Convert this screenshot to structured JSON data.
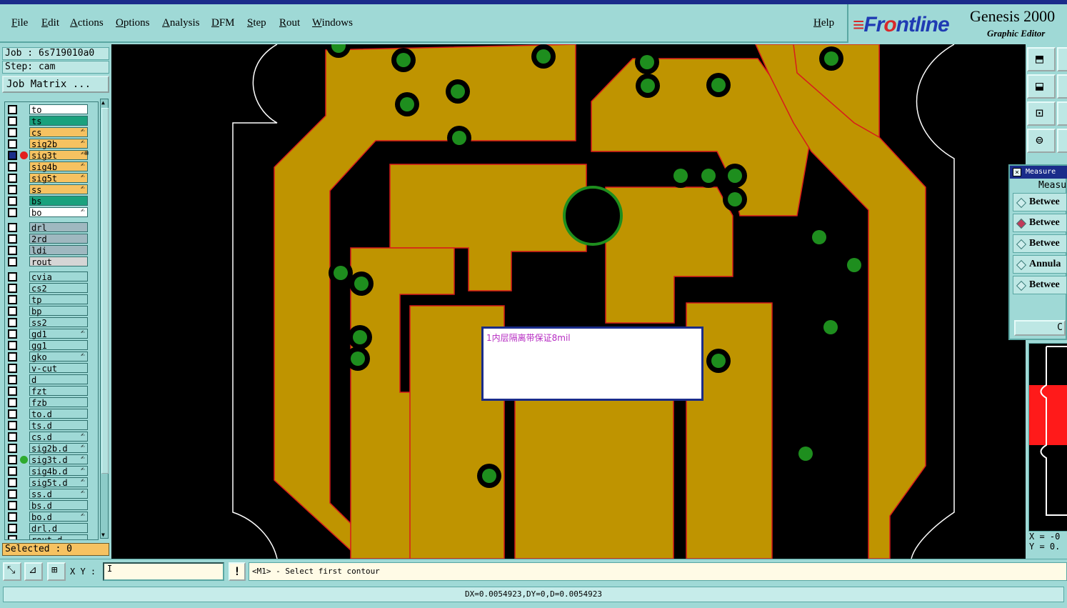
{
  "menu": {
    "items": [
      "File",
      "Edit",
      "Actions",
      "Options",
      "Analysis",
      "DFM",
      "Step",
      "Rout",
      "Windows"
    ],
    "help": "Help"
  },
  "logo": {
    "brand_left": "Fr",
    "brand_mid": "o",
    "brand_right": "ntline",
    "product": "Genesis 2000",
    "subtitle": "Graphic Editor"
  },
  "job": {
    "job_line": "Job : 6s719010a0",
    "step_line": "Step: cam",
    "matrix_button": "Job Matrix ..."
  },
  "layers": [
    {
      "name": "to",
      "bg": "#ffffff",
      "flag": "",
      "dot": ""
    },
    {
      "name": "ts",
      "bg": "#1aa17d",
      "flag": "",
      "dot": ""
    },
    {
      "name": "cs",
      "bg": "#f6c261",
      "flag": "✍",
      "dot": ""
    },
    {
      "name": "sig2b",
      "bg": "#f6c261",
      "flag": "✍",
      "dot": ""
    },
    {
      "name": "sig3t",
      "bg": "#f6c261",
      "flag": "✍⊞",
      "dot": "#e21f1f",
      "checked": true
    },
    {
      "name": "sig4b",
      "bg": "#f6c261",
      "flag": "✍",
      "dot": ""
    },
    {
      "name": "sig5t",
      "bg": "#f6c261",
      "flag": "✍",
      "dot": ""
    },
    {
      "name": "ss",
      "bg": "#f6c261",
      "flag": "✍",
      "dot": ""
    },
    {
      "name": "bs",
      "bg": "#1aa17d",
      "flag": "",
      "dot": ""
    },
    {
      "name": "bo",
      "bg": "#ffffff",
      "flag": "✍",
      "dot": ""
    },
    {
      "name": "drl",
      "bg": "#9fb8c0",
      "flag": "",
      "dot": "",
      "gap": true
    },
    {
      "name": "2rd",
      "bg": "#9fb8c0",
      "flag": "",
      "dot": ""
    },
    {
      "name": "ldi",
      "bg": "#9fb8c0",
      "flag": "",
      "dot": ""
    },
    {
      "name": "rout",
      "bg": "#d5d5d5",
      "flag": "",
      "dot": ""
    },
    {
      "name": "cvia",
      "bg": "#9fd9d6",
      "flag": "",
      "dot": "",
      "gap": true
    },
    {
      "name": "cs2",
      "bg": "#9fd9d6",
      "flag": "",
      "dot": ""
    },
    {
      "name": "tp",
      "bg": "#9fd9d6",
      "flag": "",
      "dot": ""
    },
    {
      "name": "bp",
      "bg": "#9fd9d6",
      "flag": "",
      "dot": ""
    },
    {
      "name": "ss2",
      "bg": "#9fd9d6",
      "flag": "",
      "dot": ""
    },
    {
      "name": "gd1",
      "bg": "#9fd9d6",
      "flag": "✍",
      "dot": ""
    },
    {
      "name": "gg1",
      "bg": "#9fd9d6",
      "flag": "",
      "dot": ""
    },
    {
      "name": "gko",
      "bg": "#9fd9d6",
      "flag": "✍",
      "dot": ""
    },
    {
      "name": "v-cut",
      "bg": "#9fd9d6",
      "flag": "",
      "dot": ""
    },
    {
      "name": "d",
      "bg": "#9fd9d6",
      "flag": "",
      "dot": ""
    },
    {
      "name": "fzt",
      "bg": "#9fd9d6",
      "flag": "",
      "dot": ""
    },
    {
      "name": "fzb",
      "bg": "#9fd9d6",
      "flag": "",
      "dot": ""
    },
    {
      "name": "to.d",
      "bg": "#9fd9d6",
      "flag": "",
      "dot": ""
    },
    {
      "name": "ts.d",
      "bg": "#9fd9d6",
      "flag": "",
      "dot": ""
    },
    {
      "name": "cs.d",
      "bg": "#9fd9d6",
      "flag": "✍",
      "dot": ""
    },
    {
      "name": "sig2b.d",
      "bg": "#9fd9d6",
      "flag": "✍",
      "dot": ""
    },
    {
      "name": "sig3t.d",
      "bg": "#9fd9d6",
      "flag": "✍",
      "dot": "#2faa2f"
    },
    {
      "name": "sig4b.d",
      "bg": "#9fd9d6",
      "flag": "✍",
      "dot": ""
    },
    {
      "name": "sig5t.d",
      "bg": "#9fd9d6",
      "flag": "✍",
      "dot": ""
    },
    {
      "name": "ss.d",
      "bg": "#9fd9d6",
      "flag": "✍",
      "dot": ""
    },
    {
      "name": "bs.d",
      "bg": "#9fd9d6",
      "flag": "",
      "dot": ""
    },
    {
      "name": "bo.d",
      "bg": "#9fd9d6",
      "flag": "✍",
      "dot": ""
    },
    {
      "name": "drl.d",
      "bg": "#9fd9d6",
      "flag": "",
      "dot": ""
    },
    {
      "name": "rout.d",
      "bg": "#9fd9d6",
      "flag": "",
      "dot": ""
    }
  ],
  "selected": "Selected : 0",
  "popup": {
    "text": "1内层隔离带保证8mil"
  },
  "measure": {
    "title": "Measure",
    "heading": "Measu",
    "options": [
      "Betwee",
      "Betwee",
      "Betwee",
      "Annula",
      "Betwee"
    ],
    "selected_index": 1,
    "close_label": "C"
  },
  "coords": {
    "x": "X = -0",
    "y": "Y = 0."
  },
  "bottom": {
    "xy_label": "X Y :",
    "xy_value": "I",
    "excl": "!",
    "prompt": "<M1> - Select first contour"
  },
  "status": "DX=0.0054923,DY=0,D=0.0054923",
  "colors": {
    "copper": "#bf9400",
    "pad": "#1e8e1e",
    "edge": "#d81b1b",
    "outline": "#ffffff"
  }
}
